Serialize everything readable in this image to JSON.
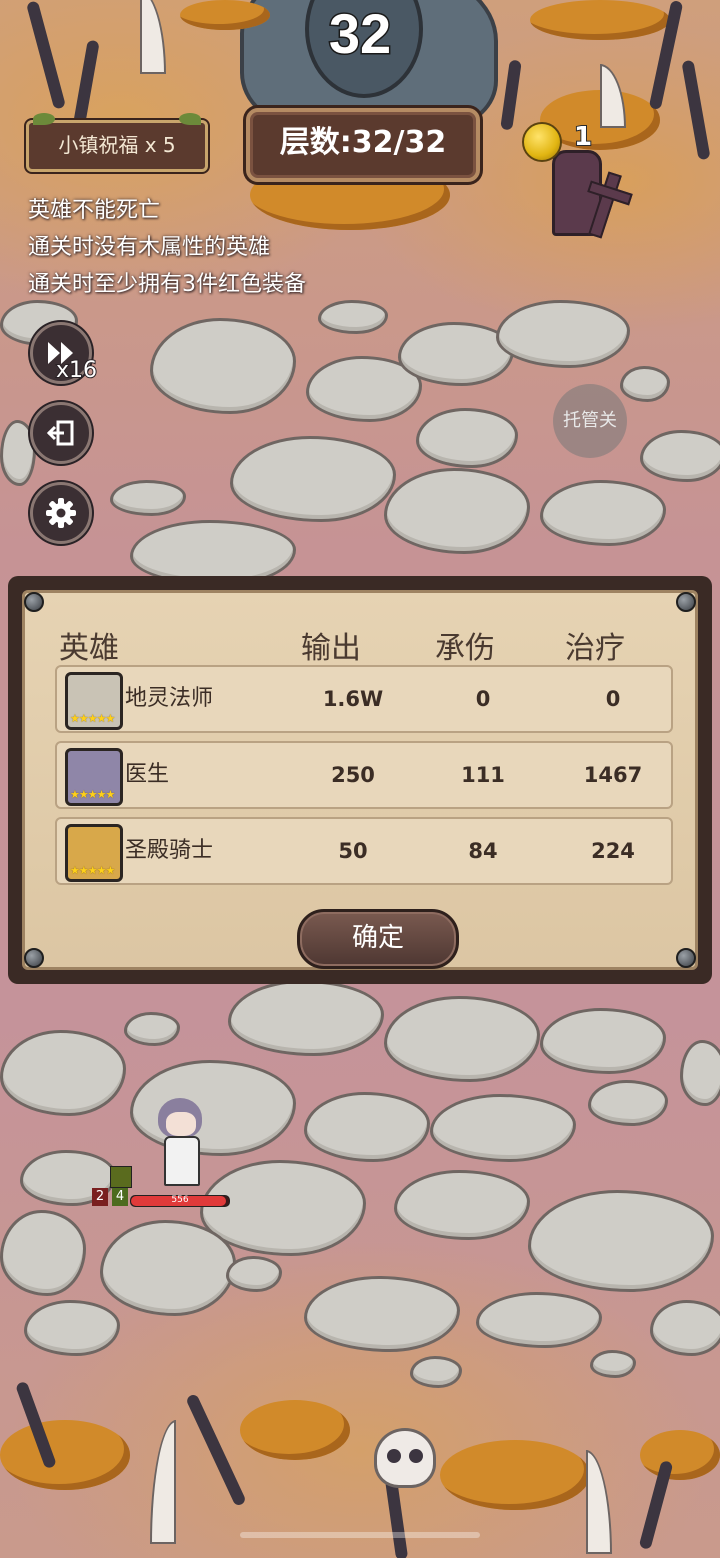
{
  "hud": {
    "current_floor": "32",
    "blessing_label": "小镇祝福 x 5",
    "layer_label": "层数:32/32",
    "coin_count": "1"
  },
  "quests": [
    "英雄不能死亡",
    "通关时没有木属性的英雄",
    "通关时至少拥有3件红色装备"
  ],
  "controls": {
    "speed_label": "x16",
    "auto_label": "托管关"
  },
  "result_panel": {
    "columns": [
      "英雄",
      "输出",
      "承伤",
      "治疗"
    ],
    "rows": [
      {
        "name": "地灵法师",
        "output": "1.6W",
        "damage_taken": "0",
        "healing": "0",
        "portrait_color": "#c9c3b5",
        "stars": "★★★★★"
      },
      {
        "name": "医生",
        "output": "250",
        "damage_taken": "111",
        "healing": "1467",
        "portrait_color": "#8f86a8",
        "stars": "★★★★★"
      },
      {
        "name": "圣殿骑士",
        "output": "50",
        "damage_taken": "84",
        "healing": "224",
        "portrait_color": "#d8a84a",
        "stars": "★★★★★"
      }
    ],
    "confirm_label": "确定"
  },
  "battle_unit": {
    "level_a": "2",
    "level_b": "4",
    "hp_text": "556",
    "hp_fraction": 0.97
  },
  "colors": {
    "panel_bg": "#e6d3b3",
    "hp_red": "#e03a3a",
    "coin_gold": "#e1b512"
  }
}
